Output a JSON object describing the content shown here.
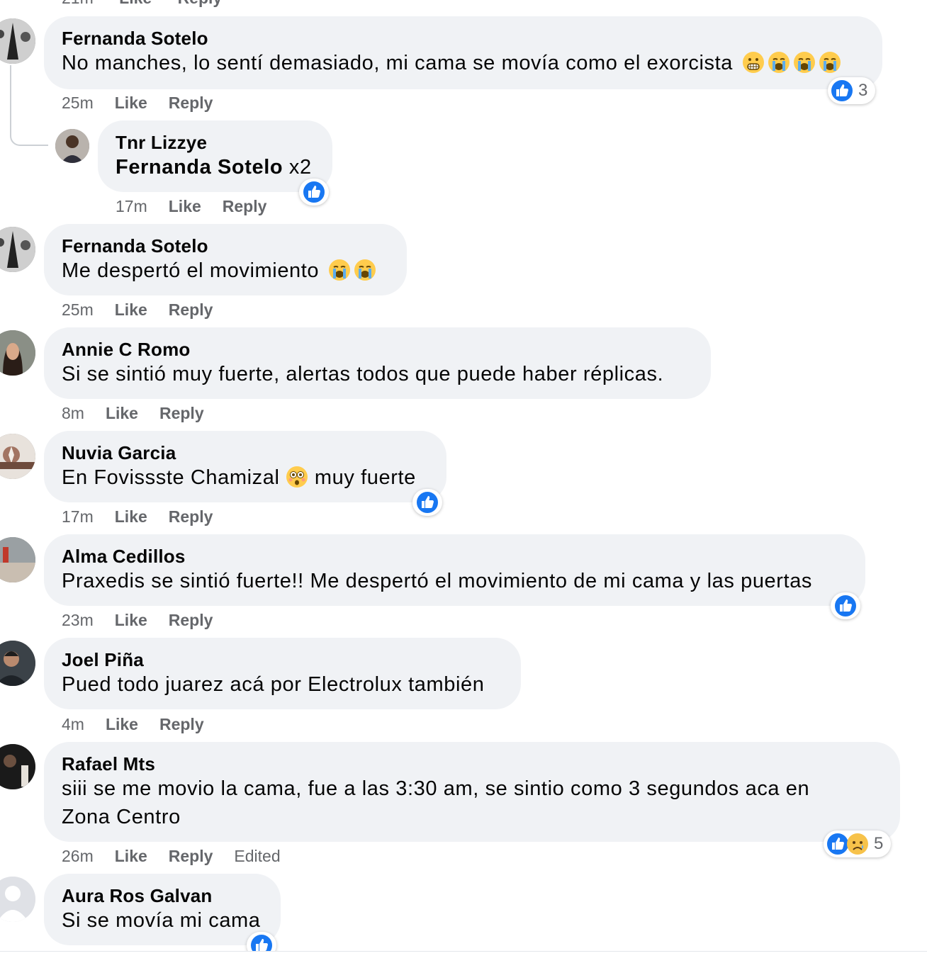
{
  "top_partial": {
    "time": "21m",
    "like": "Like",
    "reply": "Reply"
  },
  "comments": [
    {
      "author": "Fernanda Sotelo",
      "text": "No manches, lo sentí demasiado, mi cama se movía como el exorcista",
      "emojis": [
        "grimacing-face",
        "loudly-crying-face",
        "loudly-crying-face",
        "loudly-crying-face"
      ],
      "time": "25m",
      "like": "Like",
      "reply": "Reply",
      "reaction_count": "3"
    },
    {
      "author": "Tnr Lizzye",
      "mention": "Fernanda Sotelo",
      "text": " x2",
      "time": "17m",
      "like": "Like",
      "reply": "Reply"
    },
    {
      "author": "Fernanda Sotelo",
      "text": "Me despertó el movimiento",
      "emojis": [
        "loudly-crying-face",
        "loudly-crying-face"
      ],
      "time": "25m",
      "like": "Like",
      "reply": "Reply"
    },
    {
      "author": "Annie C Romo",
      "text": "Si se sintió muy fuerte, alertas todos que puede haber réplicas.",
      "time": "8m",
      "like": "Like",
      "reply": "Reply"
    },
    {
      "author": "Nuvia Garcia",
      "text_before": "En Fovissste Chamizal ",
      "text_after": " muy fuerte",
      "emojis": [
        "flushed-face"
      ],
      "time": "17m",
      "like": "Like",
      "reply": "Reply"
    },
    {
      "author": "Alma Cedillos",
      "text": "Praxedis se sintió fuerte!! Me despertó el movimiento de mi cama y las puertas",
      "time": "23m",
      "like": "Like",
      "reply": "Reply"
    },
    {
      "author": "Joel Piña",
      "text": "Pued todo juarez acá por Electrolux también",
      "time": "4m",
      "like": "Like",
      "reply": "Reply"
    },
    {
      "author": "Rafael Mts",
      "text": "siii se me movio la cama, fue a las 3:30 am, se sintio como 3 segundos aca en Zona Centro",
      "time": "26m",
      "like": "Like",
      "reply": "Reply",
      "edited": "Edited",
      "reaction_count": "5"
    },
    {
      "author": "Aura Ros Galvan",
      "text": "Si se movía mi cama"
    }
  ],
  "colors": {
    "bubble": "#f0f2f5",
    "meta": "#65676b",
    "like_blue": "#1877f2"
  }
}
